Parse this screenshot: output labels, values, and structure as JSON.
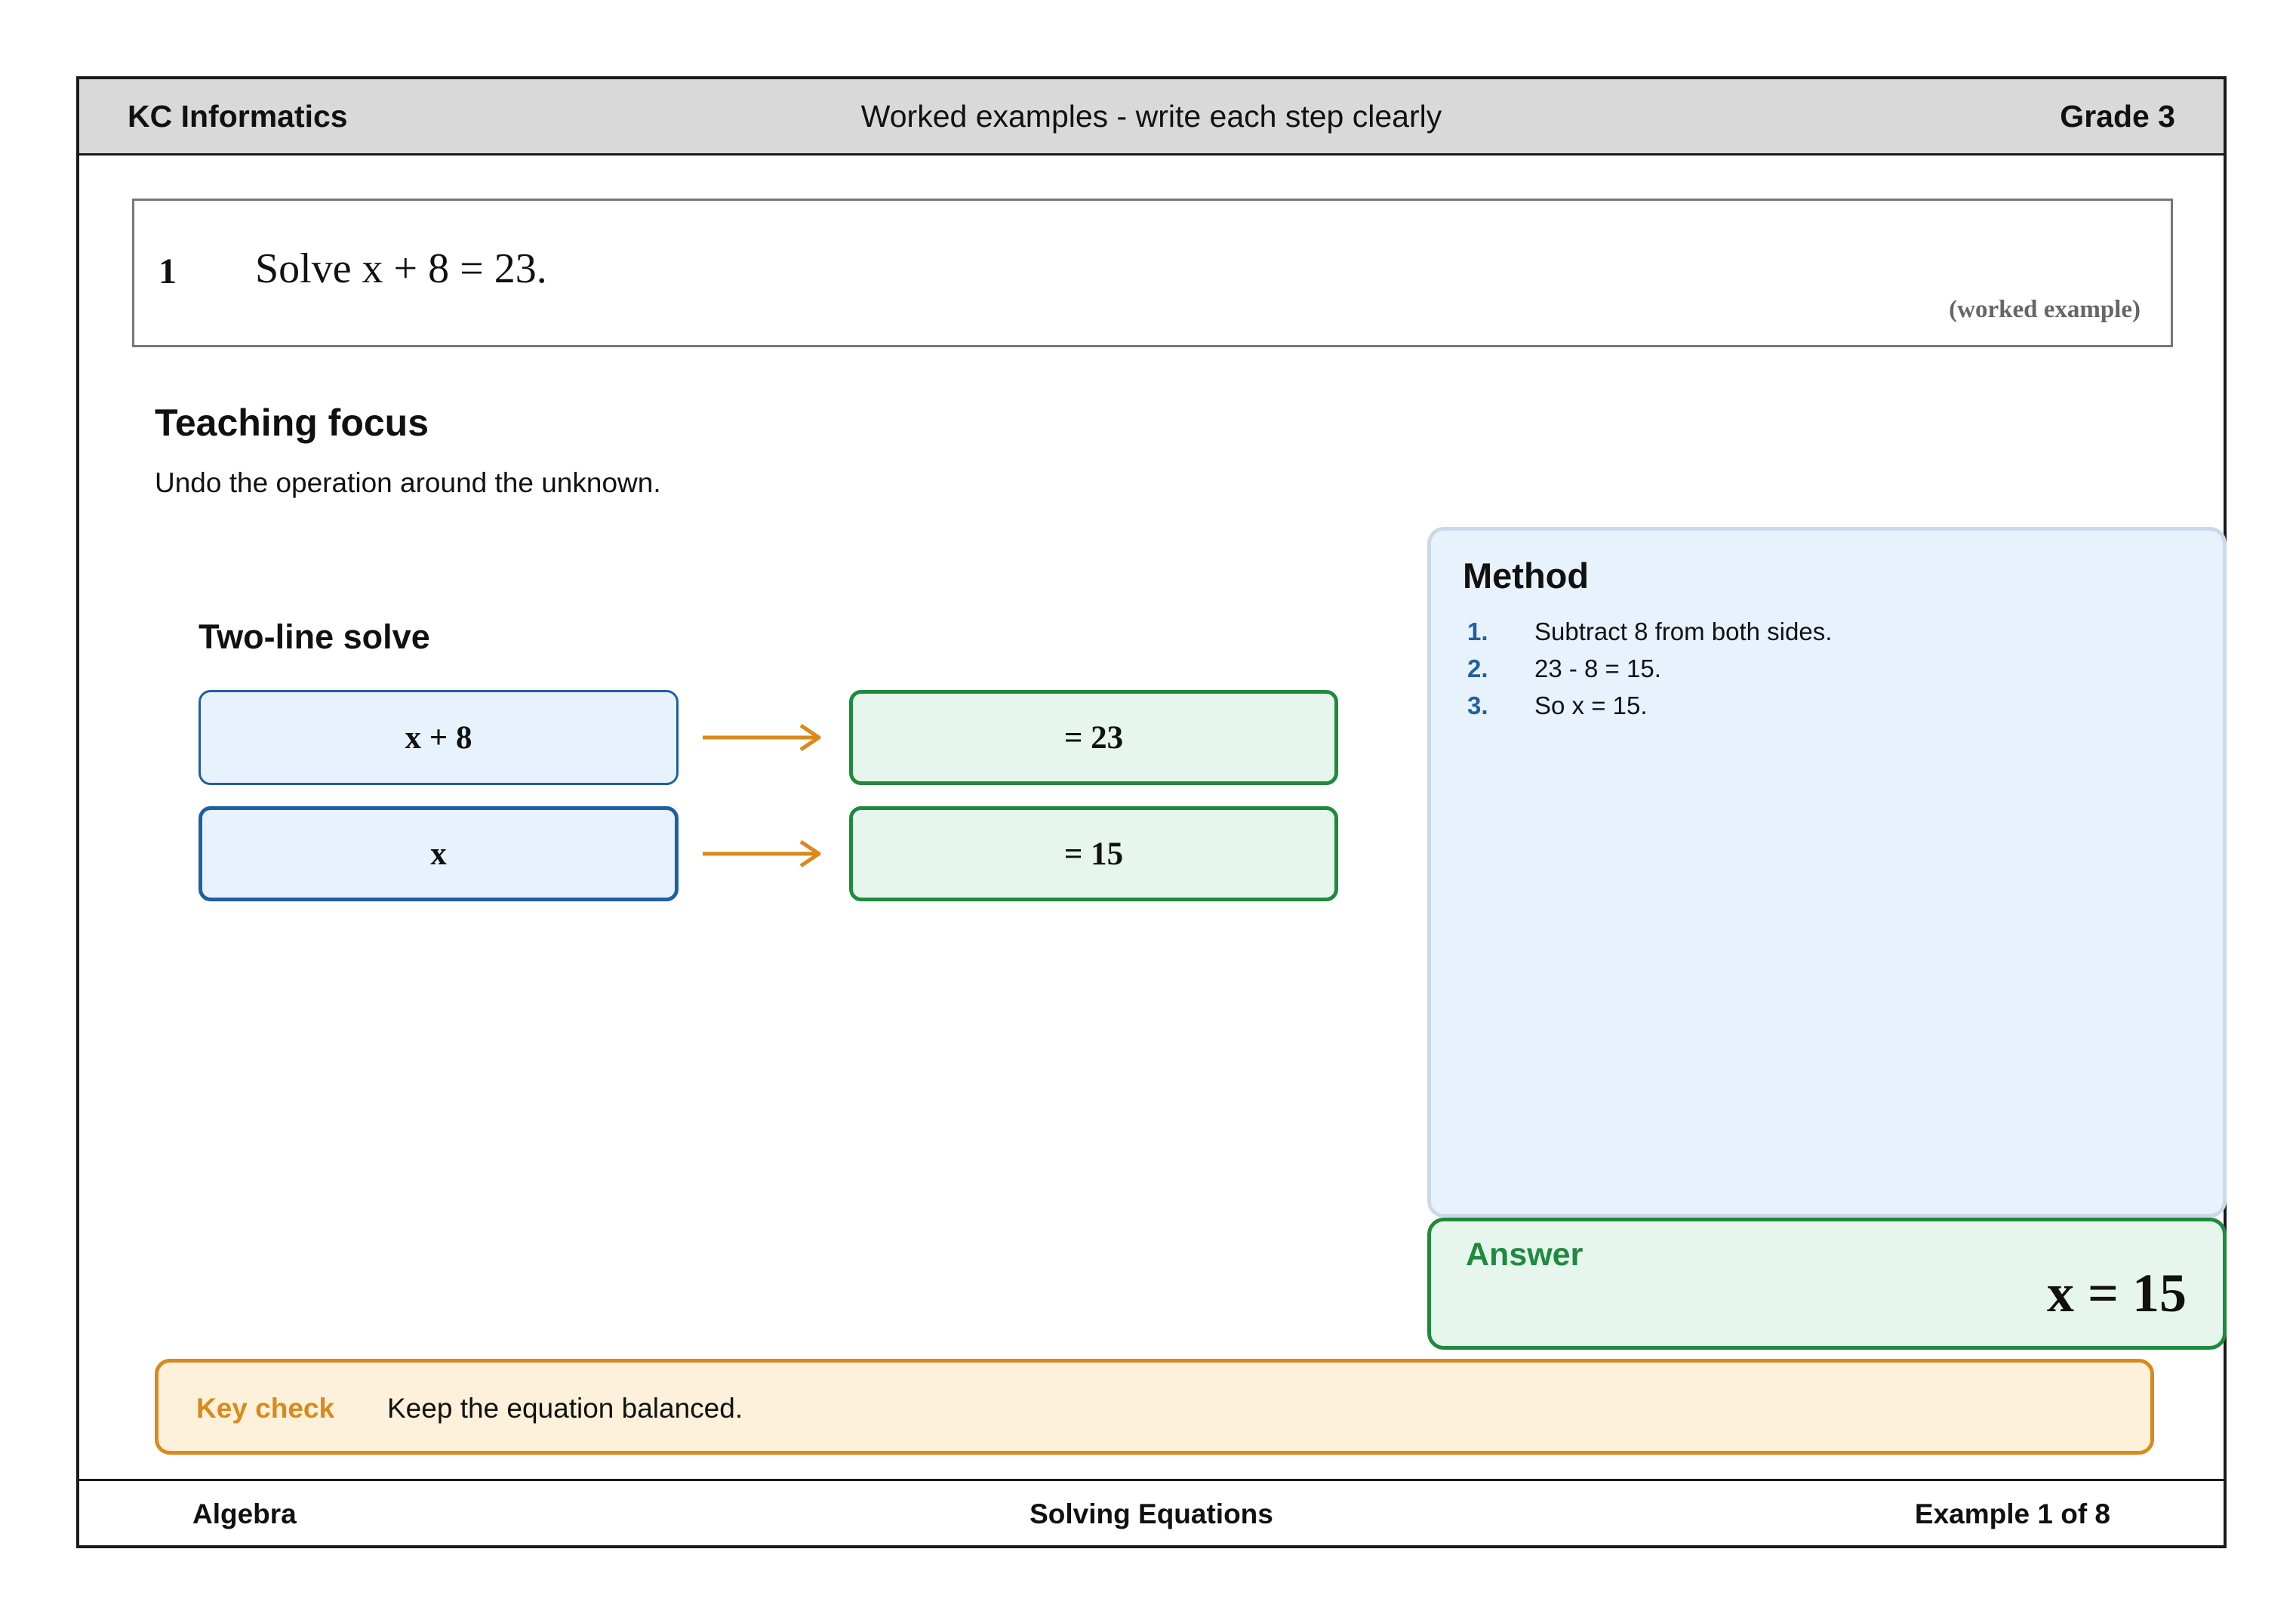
{
  "header": {
    "brand": "KC Informatics",
    "title": "Worked examples - write each step clearly",
    "grade": "Grade 3"
  },
  "question": {
    "number": "1",
    "text": "Solve x + 8 = 23.",
    "tag": "(worked example)"
  },
  "teaching_focus": {
    "title": "Teaching focus",
    "text": "Undo the operation around the unknown."
  },
  "two_line_solve": {
    "title": "Two-line solve",
    "rows": [
      {
        "left": "x + 8",
        "right": "= 23"
      },
      {
        "left": "x",
        "right": "= 15"
      }
    ]
  },
  "method": {
    "title": "Method",
    "steps": [
      {
        "num": "1.",
        "text": "Subtract 8 from both sides."
      },
      {
        "num": "2.",
        "text": "23 - 8 = 15."
      },
      {
        "num": "3.",
        "text": "So x = 15."
      }
    ]
  },
  "answer": {
    "label": "Answer",
    "value": "x = 15"
  },
  "key_check": {
    "label": "Key check",
    "text": "Keep the equation balanced."
  },
  "footer": {
    "topic": "Algebra",
    "unit": "Solving Equations",
    "progress": "Example 1 of 8"
  },
  "colors": {
    "lhs_border": "#1f5fa3",
    "rhs_border": "#1f8a3f",
    "arrow": "#d98a1a",
    "method_bg": "#e8f2fd",
    "answer_bg": "#e7f6ec",
    "keycheck_bg": "#fdf1dc"
  }
}
